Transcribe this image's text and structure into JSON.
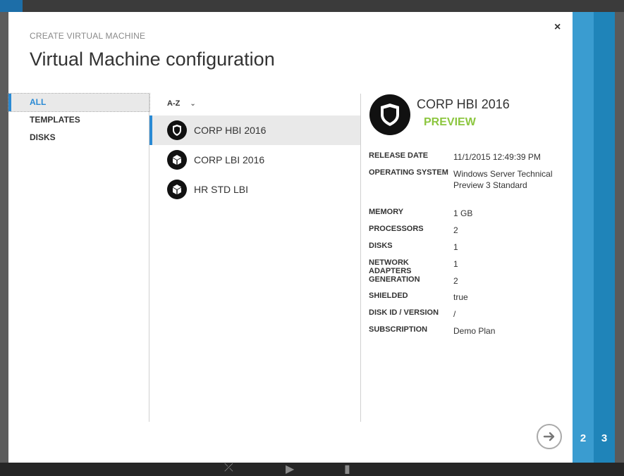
{
  "dialog": {
    "subtitle": "CREATE VIRTUAL MACHINE",
    "title": "Virtual Machine configuration",
    "close_label": "×"
  },
  "nav": {
    "items": [
      {
        "label": "ALL",
        "active": true
      },
      {
        "label": "TEMPLATES",
        "active": false
      },
      {
        "label": "DISKS",
        "active": false
      }
    ]
  },
  "list": {
    "sort_label": "A-Z",
    "items": [
      {
        "label": "CORP HBI 2016",
        "icon": "shield-icon",
        "selected": true
      },
      {
        "label": "CORP LBI 2016",
        "icon": "cube-icon",
        "selected": false
      },
      {
        "label": "HR STD LBI",
        "icon": "cube-icon",
        "selected": false
      }
    ]
  },
  "details": {
    "name": "CORP HBI 2016",
    "badge": "PREVIEW",
    "badge_color": "#8cc63f",
    "properties": [
      {
        "key": "RELEASE DATE",
        "value": "11/1/2015 12:49:39 PM"
      },
      {
        "key": "OPERATING SYSTEM",
        "value": "Windows Server Technical Preview 3 Standard"
      },
      {
        "key": "MEMORY",
        "value": "1 GB"
      },
      {
        "key": "PROCESSORS",
        "value": "2"
      },
      {
        "key": "DISKS",
        "value": "1"
      },
      {
        "key": "NETWORK ADAPTERS",
        "value": "1"
      },
      {
        "key": "GENERATION",
        "value": "2"
      },
      {
        "key": "SHIELDED",
        "value": "true"
      },
      {
        "key": "DISK ID / VERSION",
        "value": "/"
      },
      {
        "key": "SUBSCRIPTION",
        "value": "Demo Plan"
      }
    ]
  },
  "steps": {
    "step2": "2",
    "step3": "3"
  },
  "colors": {
    "accent": "#2a8ad4",
    "step2": "#3a9cd0",
    "step3": "#1f84b9"
  }
}
